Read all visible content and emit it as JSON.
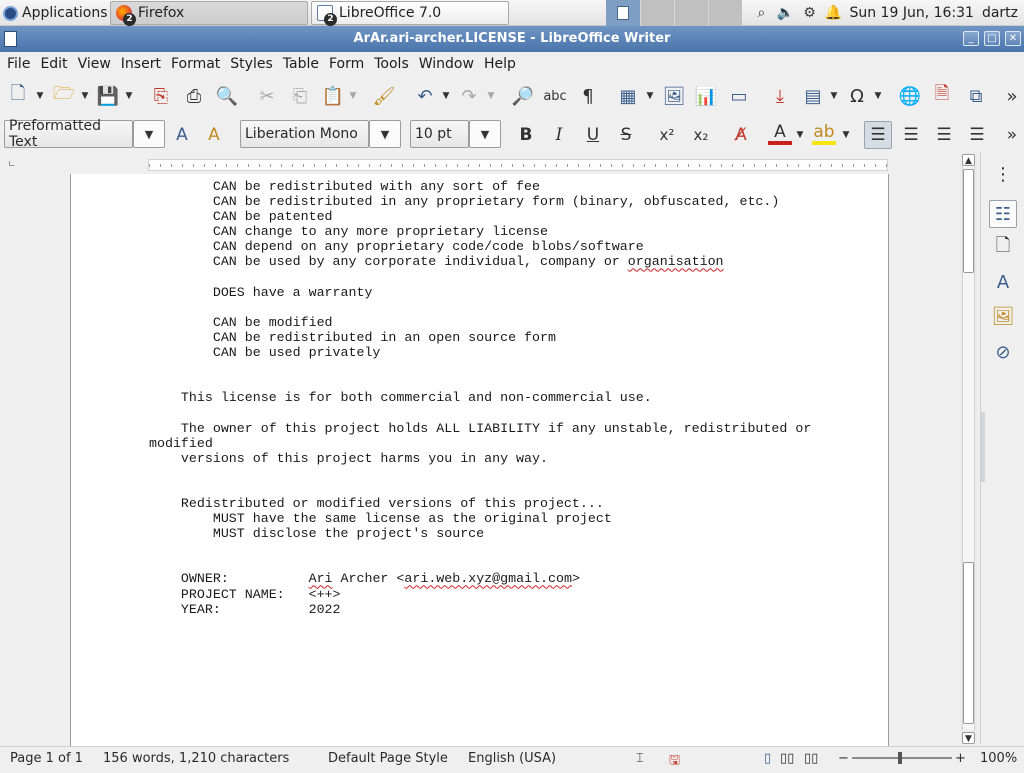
{
  "panel": {
    "applications_label": "Applications",
    "tasks": [
      {
        "label": "Firefox",
        "badge": "2"
      },
      {
        "label": "LibreOffice 7.0",
        "badge": "2"
      }
    ],
    "clock": "Sun 19 Jun, 16:31",
    "user": "dartz"
  },
  "window": {
    "title": "ArAr.ari-archer.LICENSE - LibreOffice Writer",
    "minimize": "_",
    "maximize": "□",
    "close": "✕"
  },
  "menu": [
    "File",
    "Edit",
    "View",
    "Insert",
    "Format",
    "Styles",
    "Table",
    "Form",
    "Tools",
    "Window",
    "Help"
  ],
  "format_bar": {
    "paragraph_style": "Preformatted Text",
    "font_name": "Liberation Mono",
    "font_size": "10 pt"
  },
  "document": {
    "lines": [
      {
        "indent": "        ",
        "text": "CAN be redistributed with any sort of fee"
      },
      {
        "indent": "        ",
        "text": "CAN be redistributed in any proprietary form (binary, obfuscated, etc.)"
      },
      {
        "indent": "        ",
        "text": "CAN be patented"
      },
      {
        "indent": "        ",
        "text": "CAN change to any more proprietary license"
      },
      {
        "indent": "        ",
        "text": "CAN depend on any proprietary code/code blobs/software"
      },
      {
        "indent": "        ",
        "text": "CAN be used by any corporate individual, company or ",
        "squiggle": "organisation"
      },
      {
        "indent": "",
        "text": ""
      },
      {
        "indent": "        ",
        "text": "DOES have a warranty"
      },
      {
        "indent": "",
        "text": ""
      },
      {
        "indent": "        ",
        "text": "CAN be modified"
      },
      {
        "indent": "        ",
        "text": "CAN be redistributed in an open source form"
      },
      {
        "indent": "        ",
        "text": "CAN be used privately"
      },
      {
        "indent": "",
        "text": ""
      },
      {
        "indent": "",
        "text": ""
      },
      {
        "indent": "    ",
        "text": "This license is for both commercial and non-commercial use."
      },
      {
        "indent": "",
        "text": ""
      },
      {
        "indent": "    ",
        "text": "The owner of this project holds ALL LIABILITY if any unstable, redistributed or"
      },
      {
        "indent": "",
        "text": "modified"
      },
      {
        "indent": "    ",
        "text": "versions of this project harms you in any way."
      },
      {
        "indent": "",
        "text": ""
      },
      {
        "indent": "",
        "text": ""
      },
      {
        "indent": "    ",
        "text": "Redistributed or modified versions of this project..."
      },
      {
        "indent": "        ",
        "text": "MUST have the same license as the original project"
      },
      {
        "indent": "        ",
        "text": "MUST disclose the project's source"
      },
      {
        "indent": "",
        "text": ""
      },
      {
        "indent": "",
        "text": ""
      },
      {
        "indent": "    ",
        "text": "OWNER:          ",
        "squiggle": "Ari",
        "after": " Archer <",
        "squiggle2": "ari.web.xyz@gmail.com",
        "after2": ">"
      },
      {
        "indent": "    ",
        "text": "PROJECT NAME:   <++>"
      },
      {
        "indent": "    ",
        "text": "YEAR:           2022"
      }
    ]
  },
  "status": {
    "page": "Page 1 of 1",
    "words": "156 words, 1,210 characters",
    "page_style": "Default Page Style",
    "language": "English (USA)",
    "zoom": "100%"
  }
}
